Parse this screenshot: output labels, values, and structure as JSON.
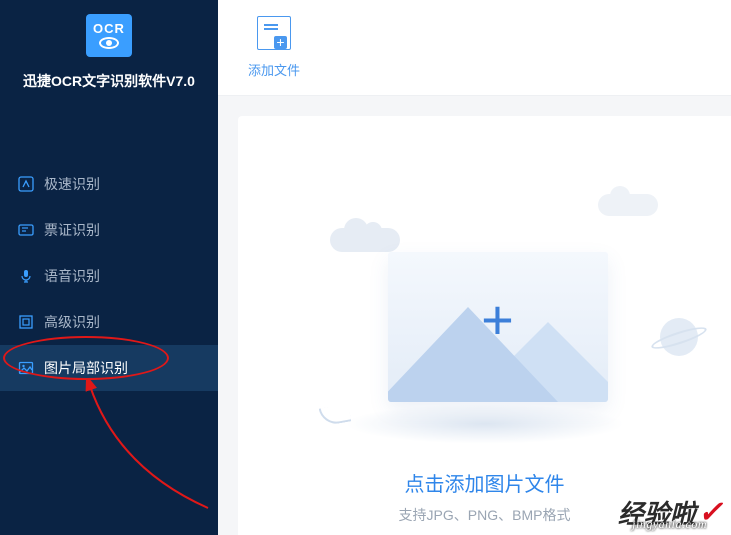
{
  "brand": {
    "icon_label": "OCR",
    "title": "迅捷OCR文字识别软件V7.0"
  },
  "sidebar": {
    "items": [
      {
        "label": "极速识别",
        "icon": "speed-icon",
        "active": false
      },
      {
        "label": "票证识别",
        "icon": "ticket-icon",
        "active": false
      },
      {
        "label": "语音识别",
        "icon": "mic-icon",
        "active": false
      },
      {
        "label": "高级识别",
        "icon": "advanced-icon",
        "active": false
      },
      {
        "label": "图片局部识别",
        "icon": "image-icon",
        "active": true
      }
    ]
  },
  "toolbar": {
    "add_file_label": "添加文件"
  },
  "drop_zone": {
    "title": "点击添加图片文件",
    "subtitle": "支持JPG、PNG、BMP格式"
  },
  "watermark": {
    "main": "经验啦",
    "sub": "jingyanla.com"
  },
  "annotation": {
    "circle_target": "sidebar-item-image-region"
  }
}
